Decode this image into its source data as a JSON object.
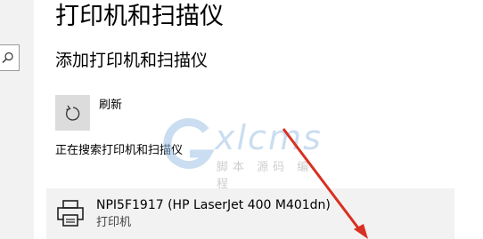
{
  "page": {
    "title": "打印机和扫描仪",
    "section_title": "添加打印机和扫描仪"
  },
  "refresh": {
    "label": "刷新",
    "icon": "refresh-icon"
  },
  "status": "正在搜索打印机和扫描仪",
  "devices": [
    {
      "name": "NPI5F1917 (HP LaserJet 400 M401dn)",
      "type": "打印机",
      "icon": "printer-icon"
    }
  ],
  "watermark": {
    "text": "xlcms",
    "subtitle": "脚本 源码 编程"
  },
  "colors": {
    "accent_arrow": "#d9301f",
    "tile_bg": "#dcdcdc",
    "row_bg": "#f2f2f2",
    "watermark": "#9fc3e6"
  }
}
